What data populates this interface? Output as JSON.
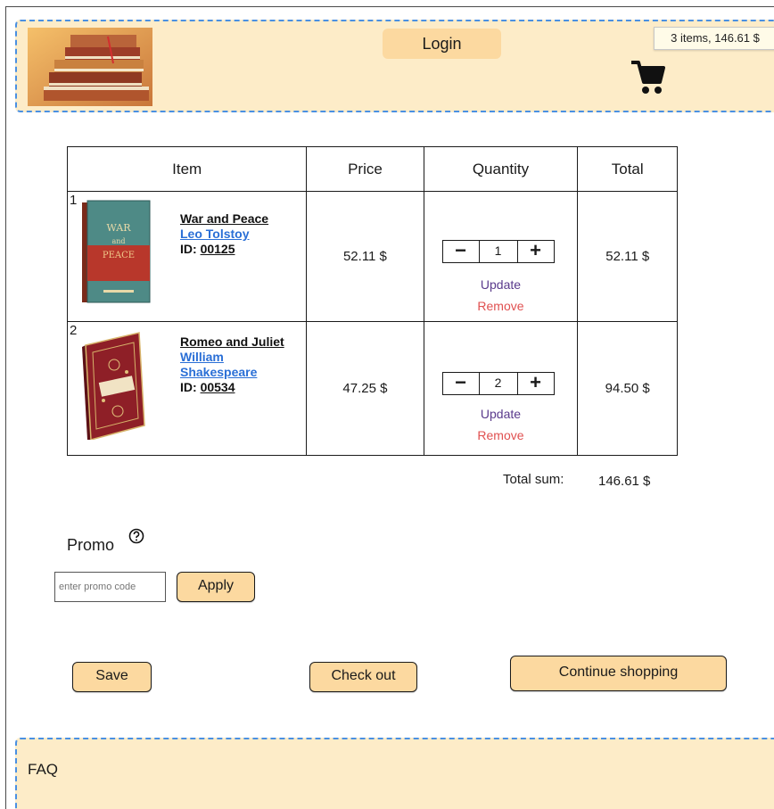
{
  "header": {
    "login_label": "Login",
    "cart_summary": "3 items, 146.61 $"
  },
  "table": {
    "headers": [
      "Item",
      "Price",
      "Quantity",
      "Total"
    ],
    "rows": [
      {
        "num": "1",
        "title": "War and Peace",
        "author": "Leo Tolstoy",
        "id_label": "ID:",
        "id": "00125",
        "price": "52.11 $",
        "quantity": "1",
        "total": "52.11 $",
        "update": "Update",
        "remove": "Remove"
      },
      {
        "num": "2",
        "title": "Romeo and Juliet",
        "author_line1": "William",
        "author_line2": "Shakespeare",
        "id_label": "ID:",
        "id": "00534",
        "price": "47.25 $",
        "quantity": "2",
        "total": "94.50 $",
        "update": "Update",
        "remove": "Remove"
      }
    ],
    "minus": "−",
    "plus": "+"
  },
  "summary": {
    "label": "Total sum:",
    "value": "146.61 $"
  },
  "promo": {
    "label": "Promo",
    "placeholder": "enter promo code",
    "apply_label": "Apply"
  },
  "actions": {
    "save_label": "Save",
    "checkout_label": "Check out",
    "continue_label": "Continue shopping"
  },
  "footer": {
    "faq_label": "FAQ"
  },
  "colors": {
    "panel_bg": "#fdecc8",
    "button_bg": "#fcd9a0",
    "dashed_border": "#4a90e2",
    "link_blue": "#2a6fd6",
    "update_purple": "#5a3a8c",
    "remove_red": "#e05050"
  },
  "icons": [
    "books-logo",
    "cart-icon",
    "help-icon",
    "book-cover-war-and-peace",
    "book-cover-romeo-and-juliet"
  ]
}
